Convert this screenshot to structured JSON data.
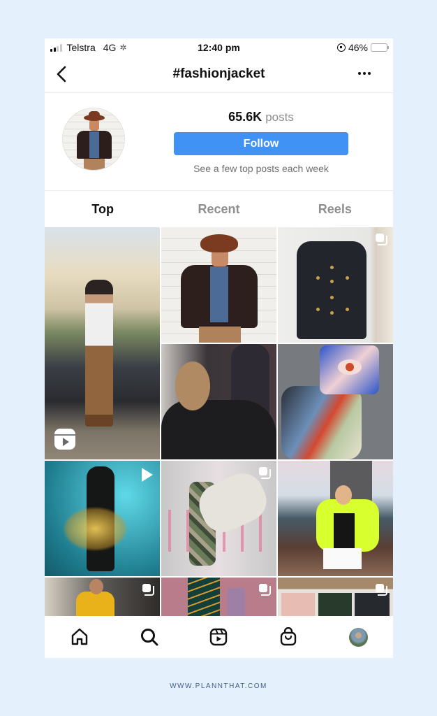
{
  "status_bar": {
    "carrier": "Telstra",
    "network": "4G",
    "time": "12:40 pm",
    "battery_percent": "46%",
    "battery_level": 0.46,
    "signal_bars_active": 2,
    "signal_bars_total": 4
  },
  "header": {
    "title": "#fashionjacket",
    "back_icon": "chevron-left-icon",
    "more_icon": "more-horizontal-icon"
  },
  "hashtag": {
    "posts_count": "65.6K",
    "posts_label": "posts",
    "follow_label": "Follow",
    "subtitle": "See a few top posts each week"
  },
  "tabs": [
    {
      "label": "Top",
      "active": true
    },
    {
      "label": "Recent",
      "active": false
    },
    {
      "label": "Reels",
      "active": false
    }
  ],
  "grid": {
    "posts": [
      {
        "description": "Man leaning on car",
        "overlay": "reel-icon"
      },
      {
        "description": "Man in hat and leather jacket",
        "overlay": null
      },
      {
        "description": "Black leather jacket on hanger",
        "overlay": "carousel-icon"
      },
      {
        "description": "Woman with ponytail facing man in sunglasses",
        "overlay": null
      },
      {
        "description": "Colorful puffer vests",
        "overlay": null
      },
      {
        "description": "Light-up skirt on teal background",
        "overlay": "play-icon"
      },
      {
        "description": "Woman in white puffer and camo pants",
        "overlay": "carousel-icon"
      },
      {
        "description": "Woman in neon jacket",
        "overlay": null
      },
      {
        "description": "Man in yellow jacket",
        "overlay": "carousel-icon"
      },
      {
        "description": "Two people in colorful coats",
        "overlay": "carousel-icon"
      },
      {
        "description": "Jackets on store rack",
        "overlay": "carousel-icon"
      }
    ]
  },
  "bottom_nav": [
    {
      "name": "home",
      "icon": "home-icon"
    },
    {
      "name": "search",
      "icon": "search-icon"
    },
    {
      "name": "reels",
      "icon": "reels-icon"
    },
    {
      "name": "shop",
      "icon": "shopping-bag-icon"
    },
    {
      "name": "profile",
      "icon": "profile-avatar"
    }
  ],
  "footer": {
    "text": "WWW.PLANNTHAT.COM"
  },
  "colors": {
    "page_background": "#e5f0fd",
    "follow_button": "#4093f5",
    "battery_fill": "#f5c431",
    "footer_text": "#3f5f86"
  }
}
